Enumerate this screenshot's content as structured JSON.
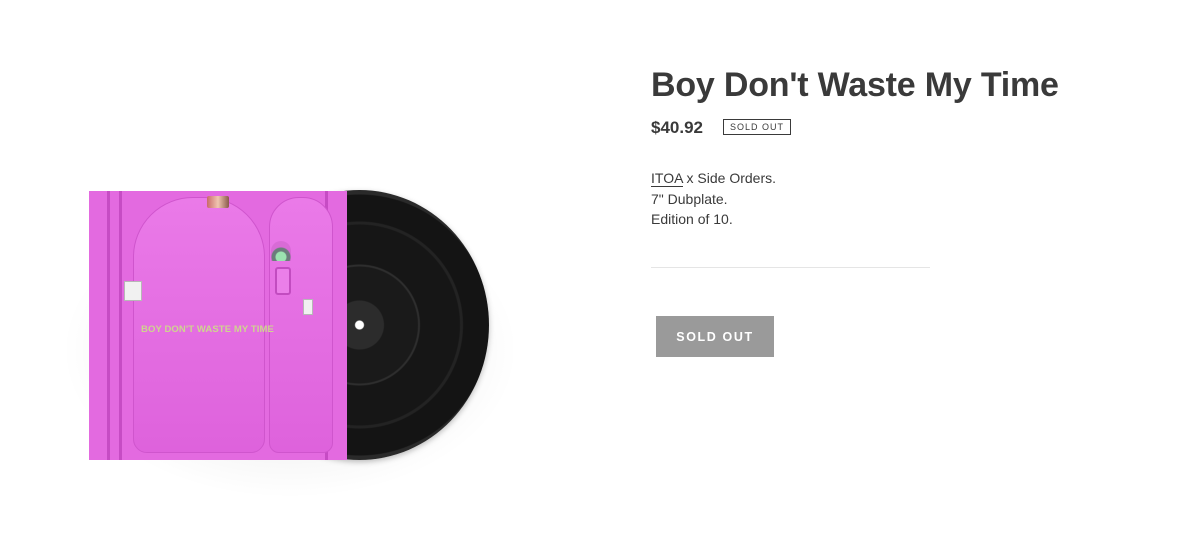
{
  "product": {
    "title": "Boy Don't Waste My Time",
    "price": "$40.92",
    "badge": "SOLD OUT",
    "description": {
      "link_text": "ITOA",
      "line1_rest": " x Side Orders.",
      "line2": "7\" Dubplate.",
      "line3": "Edition of 10."
    },
    "button_label": "SOLD OUT"
  },
  "media": {
    "sleeve_text": "BOY DON'T WASTE MY TIME",
    "sleeve_color": "#e36ae0",
    "record_color": "#1a1a1a"
  },
  "colors": {
    "text": "#3a3a3a",
    "button_bg": "#9a9a9a",
    "divider": "#e5e5e5"
  }
}
